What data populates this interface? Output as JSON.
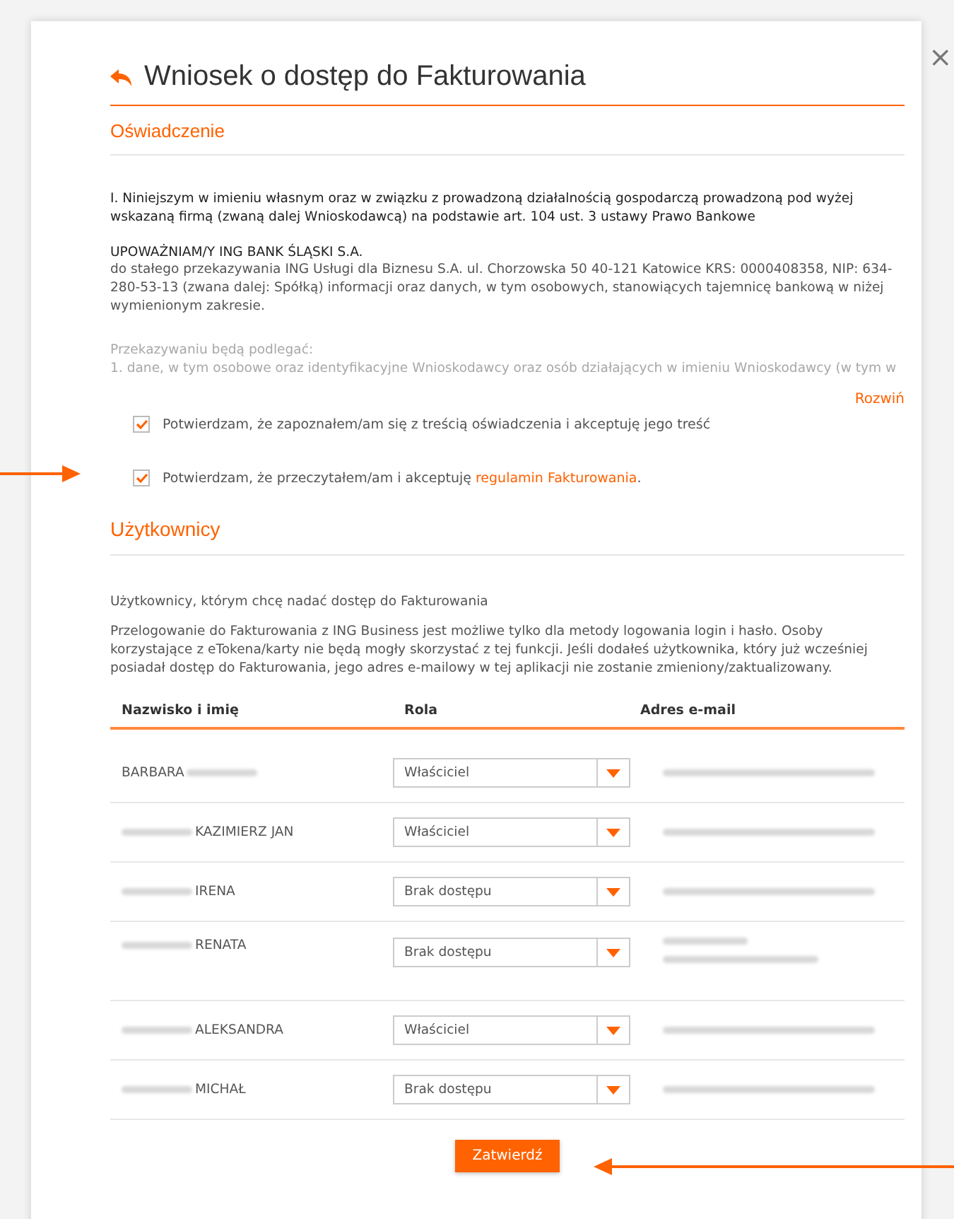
{
  "dialog": {
    "title": "Wniosek o dostęp do Fakturowania",
    "close": "×"
  },
  "declaration": {
    "heading": "Oświadczenie",
    "intro": "I. Niniejszym w imieniu własnym oraz w związku z prowadzoną działalnością gospodarczą prowadzoną pod wyżej wskazaną firmą (zwaną dalej Wnioskodawcą) na podstawie art. 104 ust. 3 ustawy Prawo Bankowe",
    "authorize_heading": "UPOWAŻNIAM/Y ING BANK ŚLĄSKI S.A.",
    "authorize_text": "do stałego przekazywania ING Usługi dla Biznesu S.A. ul. Chorzowska 50 40-121 Katowice KRS: 0000408358, NIP: 634-280-53-13 (zwana dalej: Spółką) informacji oraz danych, w tym osobowych, stanowiących tajemnicę bankową w niżej wymienionym zakresie.",
    "collapsed_lines": [
      "Przekazywaniu będą podlegać:",
      "1. dane, w tym osobowe oraz identyfikacyjne Wnioskodawcy oraz osób działających w imieniu Wnioskodawcy (w tym w"
    ],
    "expand_link": "Rozwiń",
    "consents": [
      {
        "text": "Potwierdzam, że zapoznałem/am się z treścią oświadczenia i akceptuję jego treść",
        "checked": true
      },
      {
        "text": "Potwierdzam, że przeczytałem/am i akceptuję ",
        "link": "regulamin Fakturowania",
        "after": ".",
        "checked": true
      }
    ]
  },
  "users": {
    "heading": "Użytkownicy",
    "subtitle": "Użytkownicy, którym chcę nadać dostęp do Fakturowania",
    "note": "Przelogowanie do Fakturowania z ING Business jest możliwe tylko dla metody logowania login i hasło. Osoby korzystające z eTokena/karty nie będą mogły skorzystać z tej funkcji. Jeśli dodałeś użytkownika, który już wcześniej posiadał dostęp do Fakturowania, jego adres e-mailowy w tej aplikacji nie zostanie zmieniony/zaktualizowany.",
    "table": {
      "columns": [
        "Nazwisko i imię",
        "Rola",
        "Adres e-mail"
      ],
      "rows": [
        {
          "name": "BARBARA",
          "kind": "trailing",
          "role": "Właściciel"
        },
        {
          "name": "KAZIMIERZ JAN",
          "kind": "leading",
          "role": "Właściciel"
        },
        {
          "name": "IRENA",
          "kind": "leading",
          "role": "Brak dostępu"
        },
        {
          "name": "RENATA",
          "kind": "wrapped",
          "role": "Brak dostępu"
        },
        {
          "name": "ALEKSANDRA",
          "kind": "leading",
          "role": "Właściciel"
        },
        {
          "name": "MICHAŁ",
          "kind": "leading",
          "role": "Brak dostępu"
        }
      ]
    }
  },
  "submit": "Zatwierdź"
}
